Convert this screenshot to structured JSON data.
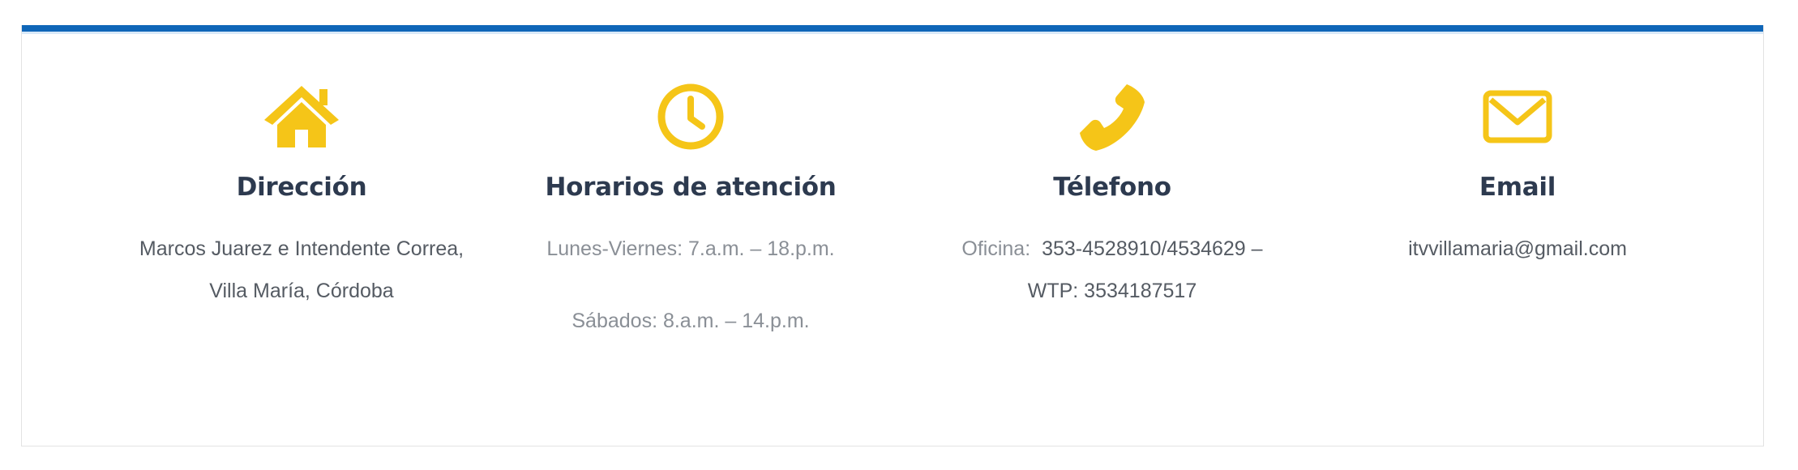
{
  "colors": {
    "accent_bar": "#0f66b8",
    "icon": "#f5c518",
    "title": "#2d3a4f",
    "text": "#555b63",
    "text_light": "#8a8f96"
  },
  "columns": [
    {
      "icon": "home-icon",
      "title": "Dirección",
      "lines": [
        "Marcos Juarez e Intendente Correa,",
        "Villa María, Córdoba"
      ]
    },
    {
      "icon": "clock-icon",
      "title": "Horarios de atención",
      "lines": [
        "Lunes-Viernes: 7.a.m. – 18.p.m.",
        "Sábados: 8.a.m. – 14.p.m."
      ]
    },
    {
      "icon": "phone-icon",
      "title": "Télefono",
      "office_label": "Oficina:",
      "office_number": "353-4528910/4534629 –",
      "whatsapp": "WTP: 3534187517"
    },
    {
      "icon": "envelope-icon",
      "title": "Email",
      "lines": [
        "itvvillamaria@gmail.com"
      ]
    }
  ]
}
